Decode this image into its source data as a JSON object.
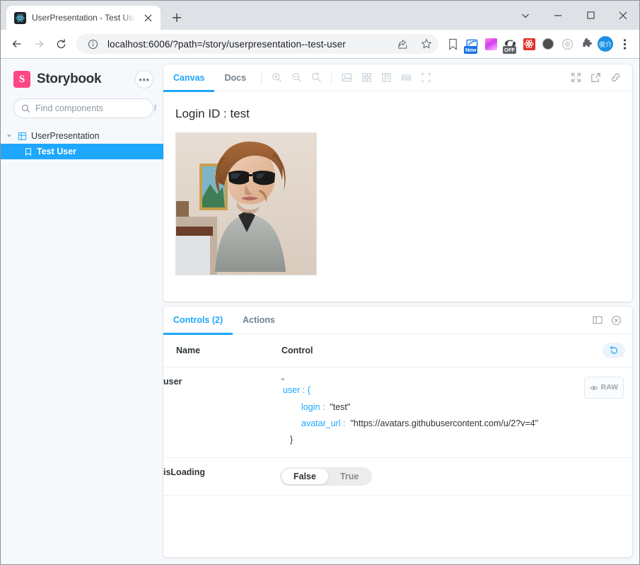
{
  "browser": {
    "tab": {
      "title": "UserPresentation - Test User · Sto",
      "favicon": "react-icon",
      "close_label": "×"
    },
    "new_tab_label": "+",
    "window_controls": {
      "tab_search": "∨",
      "minimize": "—",
      "maximize": "□",
      "close": "✕"
    },
    "nav": {
      "back": "←",
      "forward": "→",
      "reload": "⟳"
    },
    "omnibox": {
      "info_icon": "info-circle-icon",
      "url": "localhost:6006/?path=/story/userpresentation--test-user",
      "share_icon": "share-icon",
      "bookmark_icon": "star-icon"
    },
    "extensions": [
      {
        "name": "bookmark-manager-icon",
        "badge": ""
      },
      {
        "name": "screenshot-extension-icon",
        "badge": "New"
      },
      {
        "name": "gradient-extension-icon",
        "badge": ""
      },
      {
        "name": "adblock-extension-icon",
        "badge": "OFF"
      },
      {
        "name": "react-devtools-icon",
        "badge": ""
      },
      {
        "name": "dark-circle-extension-icon",
        "badge": ""
      },
      {
        "name": "target-extension-icon",
        "badge": ""
      },
      {
        "name": "puzzle-extensions-icon",
        "badge": ""
      }
    ],
    "profile": {
      "name": "profile-avatar",
      "initials": "俊介"
    },
    "menu_icon": "three-dots-vertical-icon"
  },
  "storybook": {
    "brand": "Storybook",
    "logo_letter": "S",
    "more_menu": "•••",
    "search": {
      "placeholder": "Find components",
      "value": "",
      "shortcut": "/"
    },
    "tree": [
      {
        "label": "UserPresentation",
        "type": "component",
        "level": 0,
        "selected": false,
        "expanded": true
      },
      {
        "label": "Test User",
        "type": "story",
        "level": 1,
        "selected": true
      }
    ],
    "canvas_toolbar": {
      "tabs": [
        {
          "label": "Canvas",
          "active": true
        },
        {
          "label": "Docs",
          "active": false
        }
      ],
      "tools": [
        "zoom-in-icon",
        "zoom-out-icon",
        "zoom-reset-icon",
        "background-icon",
        "grid-icon",
        "measure-icon",
        "outline-icon",
        "viewport-icon"
      ],
      "right_tools": [
        "fullscreen-icon",
        "open-in-new-tab-icon",
        "copy-link-icon"
      ]
    },
    "preview": {
      "login_label": "Login ID : test",
      "avatar_alt": "user avatar photo"
    },
    "panel": {
      "tabs": [
        {
          "label": "Controls (2)",
          "active": true
        },
        {
          "label": "Actions",
          "active": false
        }
      ],
      "right_icons": [
        "panel-position-icon",
        "close-panel-icon"
      ],
      "columns": {
        "name": "Name",
        "control": "Control",
        "reset": "reset-controls-icon"
      },
      "rows": [
        {
          "name": "user",
          "type": "object",
          "raw_button": "RAW",
          "json": {
            "open": "user : {",
            "entries": [
              {
                "key": "login :",
                "value": "\"test\""
              },
              {
                "key": "avatar_url :",
                "value": "\"https://avatars.githubusercontent.com/u/2?v=4\""
              }
            ],
            "close": "}"
          }
        },
        {
          "name": "isLoading",
          "type": "boolean",
          "options": [
            "False",
            "True"
          ],
          "selected": "False"
        }
      ]
    }
  },
  "colors": {
    "storybook_pink": "#ff4785",
    "accent_blue": "#1ea7fd",
    "chrome_bg": "#dee1e6",
    "sidebar_bg": "#f6f9fc"
  }
}
